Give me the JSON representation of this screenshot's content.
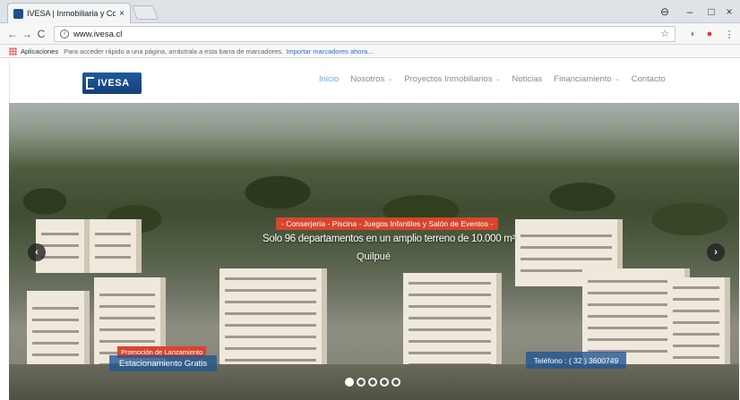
{
  "browser": {
    "tab_title": "IVESA | Inmobiliaria y Co",
    "tab_close": "×",
    "url": "www.ivesa.cl",
    "window_controls": {
      "account": "⊖",
      "minimize": "–",
      "maximize": "□",
      "close": "×"
    },
    "nav": {
      "back": "←",
      "forward": "→",
      "reload": "C"
    },
    "star": "☆",
    "bookmarks": {
      "apps_label": "Aplicaciones",
      "hint": "Para acceder rápido a una página, arrástrala a esta barra de marcadores.",
      "import_link": "Importar marcadores ahora..."
    }
  },
  "site": {
    "logo_text": "IVESA",
    "nav": [
      {
        "label": "Inicio",
        "active": true,
        "dropdown": false
      },
      {
        "label": "Nosotros",
        "active": false,
        "dropdown": true
      },
      {
        "label": "Proyectos Inmobiliarios",
        "active": false,
        "dropdown": true
      },
      {
        "label": "Noticias",
        "active": false,
        "dropdown": false
      },
      {
        "label": "Financiamiento",
        "active": false,
        "dropdown": true
      },
      {
        "label": "Contacto",
        "active": false,
        "dropdown": false
      }
    ],
    "dropdown_caret": "⌄"
  },
  "hero": {
    "amenities": "- Conserjería - Piscina - Juegos Infantiles y Salón de Eventos -",
    "headline": "Solo 96 departamentos en un amplio terreno de 10.000 m²",
    "place": "Quilpué",
    "prev_arrow": "‹",
    "next_arrow": "›",
    "promo_badge": "Promoción de Lanzamiento",
    "parking": "Estacionamiento Gratis",
    "phone": "Teléfono : ( 32 ) 3600749",
    "slides": [
      {
        "active": true
      },
      {
        "active": false
      },
      {
        "active": false
      },
      {
        "active": false
      },
      {
        "active": false
      }
    ]
  },
  "colors": {
    "brand": "#1f5aa0",
    "accent": "#d9452c",
    "nav_active": "#6aa8e0"
  }
}
